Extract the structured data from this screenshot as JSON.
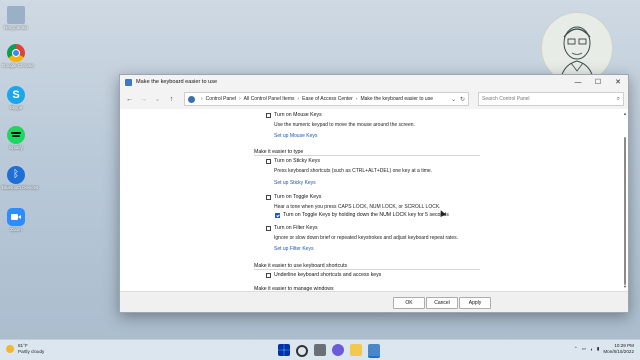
{
  "desktop": {
    "icons": [
      {
        "label": "Recycle Bin",
        "color": "#9ab0c6"
      },
      {
        "label": "Google Chrome",
        "color": "#ffffff"
      },
      {
        "label": "Skype",
        "color": "#1aa7ec"
      },
      {
        "label": "Spotify",
        "color": "#1ed760"
      },
      {
        "label": "Bluetooth Devices",
        "color": "#1f6fd6"
      },
      {
        "label": "Zoom",
        "color": "#2d8cff"
      }
    ]
  },
  "window": {
    "title": "Make the keyboard easier to use",
    "breadcrumbs": [
      "Control Panel",
      "All Control Panel Items",
      "Ease of Access Center",
      "Make the keyboard easier to use"
    ],
    "search_placeholder": "Search Control Panel",
    "mouse_keys": {
      "checkbox_label": "Turn on Mouse Keys",
      "checked": false,
      "description": "Use the numeric keypad to move the mouse around the screen.",
      "link": "Set up Mouse Keys"
    },
    "section_type": "Make it easier to type",
    "sticky_keys": {
      "checkbox_label": "Turn on Sticky Keys",
      "checked": false,
      "description": "Press keyboard shortcuts (such as CTRL+ALT+DEL) one key at a time.",
      "link": "Set up Sticky Keys"
    },
    "toggle_keys": {
      "checkbox_label": "Turn on Toggle Keys",
      "checked": false,
      "description": "Hear a tone when you press CAPS LOCK, NUM LOCK, or SCROLL LOCK.",
      "sub_checkbox_label": "Turn on Toggle Keys by holding down the NUM LOCK key for 5 seconds",
      "sub_checked": true
    },
    "filter_keys": {
      "checkbox_label": "Turn on Filter Keys",
      "checked": false,
      "description": "Ignore or slow down brief or repeated keystrokes and adjust keyboard repeat rates.",
      "link": "Set up Filter Keys"
    },
    "section_shortcuts": "Make it easier to use keyboard shortcuts",
    "underline_label": "Underline keyboard shortcuts and access keys",
    "section_windows": "Make it easier to manage windows",
    "buttons": {
      "ok": "OK",
      "cancel": "Cancel",
      "apply": "Apply"
    }
  },
  "taskbar": {
    "weather_temp": "81°F",
    "weather_desc": "Partly cloudy",
    "time": "10:29 PM",
    "date": "Mon/8/15/2022"
  }
}
